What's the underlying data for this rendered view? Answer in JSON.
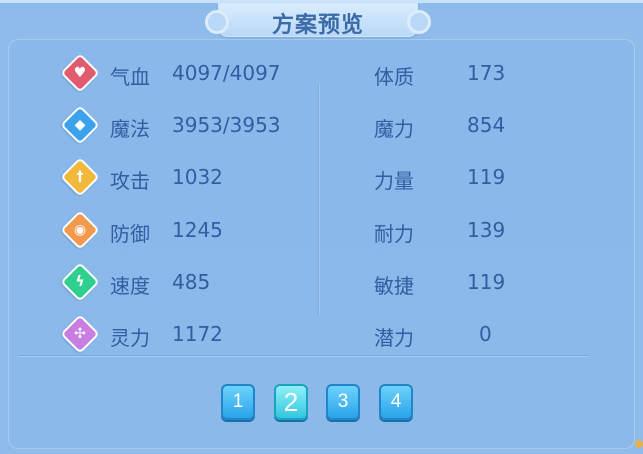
{
  "title": "方案预览",
  "left_stats": [
    {
      "label": "气血",
      "value": "4097/4097",
      "icon": "heart-icon",
      "color": "#e25a6d",
      "glyph": "♥"
    },
    {
      "label": "魔法",
      "value": "3953/3953",
      "icon": "magic-icon",
      "color": "#3ba3ee",
      "glyph": "◆"
    },
    {
      "label": "攻击",
      "value": "1032",
      "icon": "sword-icon",
      "color": "#f1b83a",
      "glyph": "†"
    },
    {
      "label": "防御",
      "value": "1245",
      "icon": "shield-icon",
      "color": "#f29a4c",
      "glyph": "◉"
    },
    {
      "label": "速度",
      "value": "485",
      "icon": "lightning-icon",
      "color": "#2fcf8f",
      "glyph": "ϟ"
    },
    {
      "label": "灵力",
      "value": "1172",
      "icon": "spirit-icon",
      "color": "#c77ee0",
      "glyph": "✣"
    }
  ],
  "right_stats": [
    {
      "label": "体质",
      "value": "173"
    },
    {
      "label": "魔力",
      "value": "854"
    },
    {
      "label": "力量",
      "value": "119"
    },
    {
      "label": "耐力",
      "value": "139"
    },
    {
      "label": "敏捷",
      "value": "119"
    },
    {
      "label": "潜力",
      "value": "0"
    }
  ],
  "pages": [
    "1",
    "2",
    "3",
    "4"
  ],
  "active_page": "2"
}
